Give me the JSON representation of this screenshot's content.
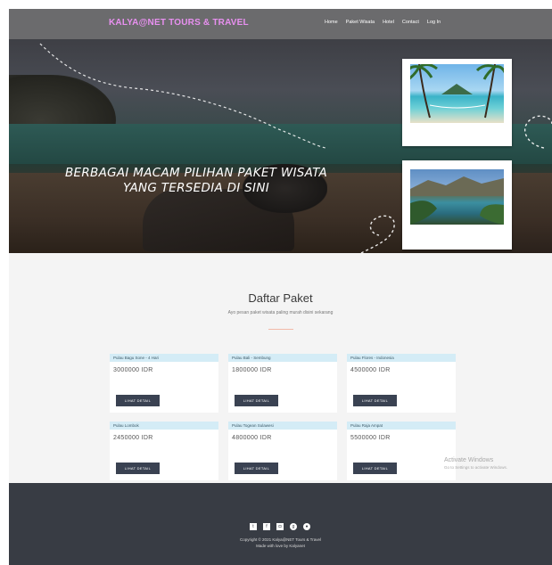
{
  "navbar": {
    "brand": "KALYA@NET TOURS & TRAVEL",
    "links": [
      "Home",
      "Paket Wisata",
      "Hotel",
      "Contact",
      "Log In"
    ]
  },
  "hero": {
    "title_line1": "BERBAGAI MACAM PILIHAN PAKET WISATA",
    "title_line2": "YANG TERSEDIA DI SINI"
  },
  "packages": {
    "title": "Daftar Paket",
    "subtitle": "Ayo pesan paket wisata paling murah disini sekarang",
    "cards": [
      {
        "name": "Pulau Bagu Sone - 4 Hari",
        "price": "3000000 IDR",
        "button": "LIHAT DETAIL"
      },
      {
        "name": "Pulau Bali - Sembung",
        "price": "1800000 IDR",
        "button": "LIHAT DETAIL"
      },
      {
        "name": "Pulau Flores - Indonesia",
        "price": "4500000 IDR",
        "button": "LIHAT DETAIL"
      },
      {
        "name": "Pulau Lombok",
        "price": "2450000 IDR",
        "button": "LIHAT DETAIL"
      },
      {
        "name": "Pulau Togean Sulawesi",
        "price": "4800000 IDR",
        "button": "LIHAT DETAIL"
      },
      {
        "name": "Pulau Raja Ampat",
        "price": "5500000 IDR",
        "button": "LIHAT DETAIL"
      }
    ]
  },
  "watermark": {
    "line1": "Activate Windows",
    "line2": "Go to Settings to activate Windows."
  },
  "footer": {
    "social_icons": [
      "twitter-icon",
      "facebook-icon",
      "instagram-icon",
      "google-plus-icon",
      "whatsapp-icon"
    ],
    "copyright": "Copyright © 2021 Kalya@NET Tours & Travel",
    "credit": "Made with love by Kalyanet"
  },
  "colors": {
    "navbar_bg": "#6b6b6d",
    "brand": "#e890f0",
    "card_header": "#d4ecf6",
    "button": "#3a4252",
    "footer_bg": "#383c44"
  }
}
